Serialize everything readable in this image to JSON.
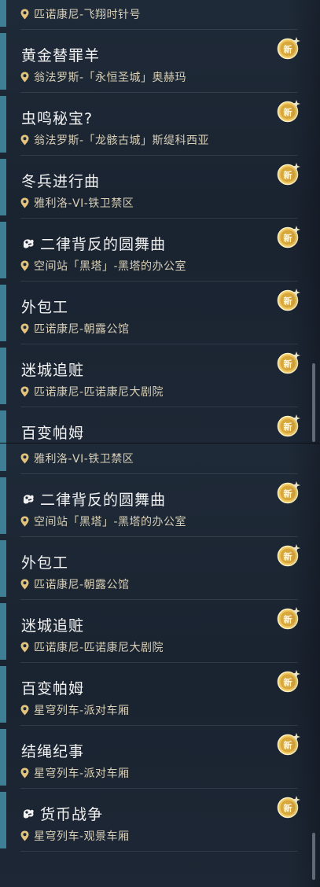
{
  "mission_list_top": [
    {
      "title": "",
      "location": "匹诺康尼-飞翔时针号",
      "has_icon": false
    },
    {
      "title": "黄金替罪羊",
      "location": "翁法罗斯-「永恒圣城」奥赫玛",
      "has_icon": false
    },
    {
      "title": "虫鸣秘宝?",
      "location": "翁法罗斯-「龙骸古城」斯缇科西亚",
      "has_icon": false
    },
    {
      "title": "冬兵进行曲",
      "location": "雅利洛-VI-铁卫禁区",
      "has_icon": false
    },
    {
      "title": "二律背反的圆舞曲",
      "location": "空间站「黑塔」-黑塔的办公室",
      "has_icon": true
    },
    {
      "title": "外包工",
      "location": "匹诺康尼-朝露公馆",
      "has_icon": false
    },
    {
      "title": "迷城追赃",
      "location": "匹诺康尼-匹诺康尼大剧院",
      "has_icon": false
    },
    {
      "title": "百变帕姆",
      "location": "",
      "has_icon": false
    }
  ],
  "mission_list_bottom": [
    {
      "title": "冬兵进行曲",
      "location": "雅利洛-VI-铁卫禁区",
      "has_icon": false
    },
    {
      "title": "二律背反的圆舞曲",
      "location": "空间站「黑塔」-黑塔的办公室",
      "has_icon": true
    },
    {
      "title": "外包工",
      "location": "匹诺康尼-朝露公馆",
      "has_icon": false
    },
    {
      "title": "迷城追赃",
      "location": "匹诺康尼-匹诺康尼大剧院",
      "has_icon": false
    },
    {
      "title": "百变帕姆",
      "location": "星穹列车-派对车厢",
      "has_icon": false
    },
    {
      "title": "结绳纪事",
      "location": "星穹列车-派对车厢",
      "has_icon": false
    },
    {
      "title": "货币战争",
      "location": "星穹列车-观景车厢",
      "has_icon": true
    }
  ],
  "new_badge_label": "新",
  "icons": {
    "location": "map-pin-icon",
    "mission": "companion-mission-icon",
    "new": "new-badge-icon"
  },
  "colors": {
    "accent_bar": "#3e7f96",
    "title": "#f2f2f2",
    "location": "#d8cfb6",
    "badge_gold": "#f0c860",
    "pin": "#e3c27a"
  }
}
